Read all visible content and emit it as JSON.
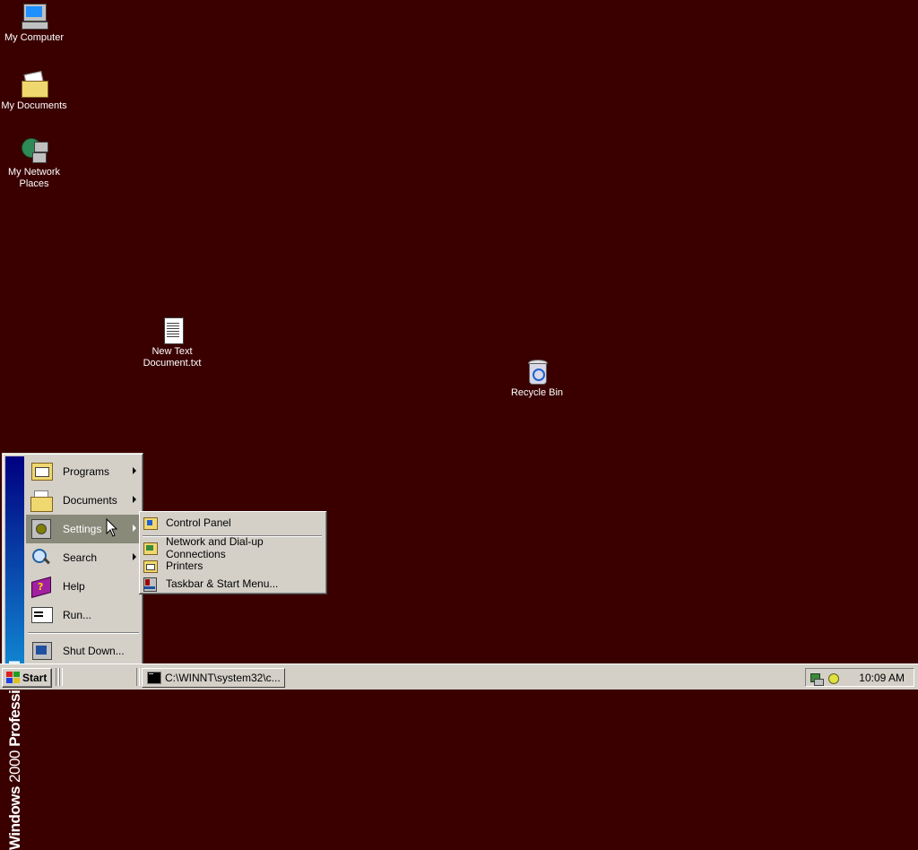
{
  "desktop": {
    "background": "#3a0000",
    "icons": [
      {
        "label": "My Computer",
        "icon": "computer-icon"
      },
      {
        "label": "My Documents",
        "icon": "folder-documents-icon"
      },
      {
        "label": "My Network Places",
        "icon": "network-places-icon"
      },
      {
        "label": "New Text Document.txt",
        "icon": "text-document-icon"
      },
      {
        "label": "Recycle Bin",
        "icon": "recycle-bin-icon"
      }
    ]
  },
  "start_menu": {
    "banner_bold": "Windows",
    "banner_light": "2000",
    "banner_bold2": "Professional",
    "items": [
      {
        "label": "Programs",
        "icon": "programs-icon"
      },
      {
        "label": "Documents",
        "icon": "documents-icon"
      },
      {
        "label": "Settings",
        "icon": "settings-icon"
      },
      {
        "label": "Search",
        "icon": "search-icon"
      },
      {
        "label": "Help",
        "icon": "help-icon"
      },
      {
        "label": "Run...",
        "icon": "run-icon"
      },
      {
        "label": "Shut Down...",
        "icon": "shutdown-icon"
      }
    ]
  },
  "settings_submenu": {
    "items": [
      {
        "label": "Control Panel",
        "icon": "control-panel-icon"
      },
      {
        "label": "Network and Dial-up Connections",
        "icon": "network-connections-icon"
      },
      {
        "label": "Printers",
        "icon": "printers-icon"
      },
      {
        "label": "Taskbar & Start Menu...",
        "icon": "taskbar-icon"
      }
    ]
  },
  "taskbar": {
    "start_label": "Start",
    "task_label": "C:\\WINNT\\system32\\c...",
    "clock": "10:09 AM"
  }
}
